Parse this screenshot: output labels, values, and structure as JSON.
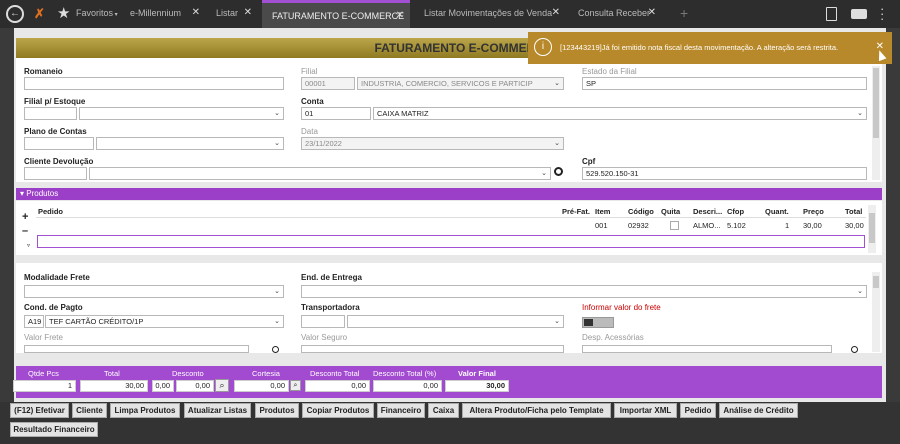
{
  "tabs": {
    "back": "←",
    "favorites": "Favoritos",
    "t1": "e-Millennium",
    "t2": "Listar",
    "t3": "FATURAMENTO E-COMMERCE",
    "t4": "Listar Movimentações de Venda",
    "t5": "Consulta Receber",
    "close": "✕",
    "add": "+"
  },
  "header": {
    "title": "FATURAMENTO E-COMMERCE"
  },
  "toast": {
    "icon": "i",
    "message": "[123443219]Já foi emitido nota fiscal desta movimentação. A alteração será restrita.",
    "close": "✕"
  },
  "form": {
    "romaneio": "Romaneio",
    "filial": "Filial",
    "filial_code": "00001",
    "filial_name": "INDUSTRIA, COMERCIO, SERVICOS E PARTICIP",
    "estado": "Estado da Filial",
    "estado_val": "SP",
    "filial_estoque": "Filial p/ Estoque",
    "conta": "Conta",
    "conta_code": "01",
    "conta_name": "CAIXA MATRIZ",
    "plano": "Plano de Contas",
    "data": "Data",
    "data_val": "23/11/2022",
    "cliente_dev": "Cliente Devolução",
    "cpf": "Cpf",
    "cpf_val": "529.520.150-31"
  },
  "produtos": {
    "title": "▾ Produtos",
    "plus": "+",
    "minus": "–",
    "cols": [
      "Pedido",
      "Pré-Fat.",
      "Item",
      "Código",
      "Quita",
      "Descri...",
      "Cfop",
      "Quant.",
      "Preço",
      "Total"
    ],
    "row": {
      "item": "001",
      "codigo": "02932",
      "descr": "ALMO...",
      "cfop": "5.102",
      "quant": "1",
      "preco": "30,00",
      "total": "30,00"
    }
  },
  "frete": {
    "modalidade": "Modalidade Frete",
    "end_entrega": "End. de Entrega",
    "cond_pagto": "Cond. de Pagto",
    "cond_code": "A19",
    "cond_name": "TEF CARTÃO CRÉDITO/1P",
    "transportadora": "Transportadora",
    "informar": "Informar valor do frete",
    "valor_frete": "Valor Frete",
    "valor_seguro": "Valor Seguro",
    "desp": "Desp. Acessórias"
  },
  "totals": {
    "qtde_label": "Qtde Pcs",
    "qtde": "1",
    "total_label": "Total",
    "total": "30,00",
    "desconto_label": "Desconto",
    "desc1": "0,00",
    "desc2": "0,00",
    "cortesia_label": "Cortesia",
    "cortesia": "0,00",
    "desc_total_label": "Desconto Total",
    "desc_total": "0,00",
    "desc_pct_label": "Desconto Total (%)",
    "desc_pct": "0,00",
    "valor_final_label": "Valor Final",
    "valor_final": "30,00"
  },
  "buttons": [
    "(F12) Efetivar",
    "Cliente",
    "Limpa Produtos",
    "Atualizar Listas",
    "Produtos",
    "Copiar Produtos",
    "Financeiro",
    "Caixa",
    "Altera Produto/Ficha pelo Template",
    "Importar XML",
    "Pedido",
    "Análise de Crédito",
    "Resultado Financeiro"
  ],
  "colors": {
    "accent": "#a050d0",
    "header": "#a8922f",
    "toast": "#b8892a"
  }
}
